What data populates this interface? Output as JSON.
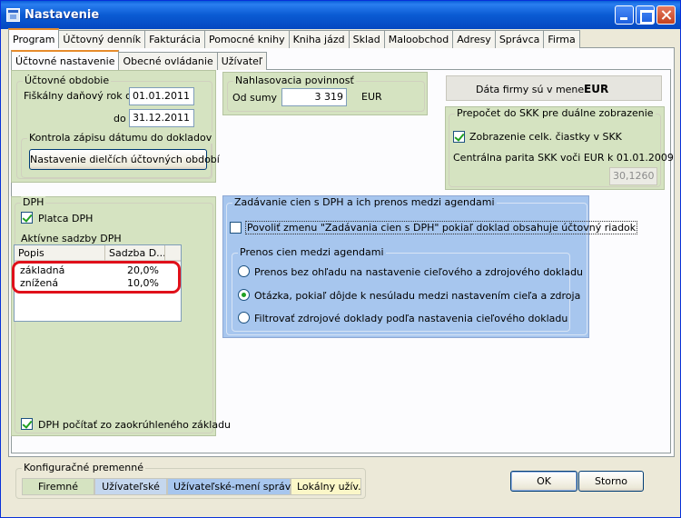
{
  "window": {
    "title": "Nastavenie"
  },
  "main_tabs": [
    "Program",
    "Účtovný denník",
    "Fakturácia",
    "Pomocné knihy",
    "Kniha jázd",
    "Sklad",
    "Maloobchod",
    "Adresy",
    "Správca",
    "Firma"
  ],
  "sub_tabs": [
    "Účtovné nastavenie",
    "Obecné ovládanie",
    "Užívateľ"
  ],
  "accounting_period": {
    "title": "Účtovné obdobie",
    "from_label": "Fiškálny daňový rok od",
    "from_value": "01.01.2011",
    "to_label": "do",
    "to_value": "31.12.2011"
  },
  "date_control": {
    "title": "Kontrola zápisu dátumu do dokladov",
    "button_label": "Nastavenie dielčích účtovných období"
  },
  "reporting": {
    "title": "Nahlasovacia povinnosť",
    "from_sum_label": "Od sumy",
    "amount": "3 319",
    "currency": "EUR"
  },
  "currency_info": {
    "label": "Dáta firmy sú v mene",
    "value": "EUR"
  },
  "conversion": {
    "title": "Prepočet do SKK pre duálne zobrazenie",
    "show_label": "Zobrazenie celk. čiastky v SKK",
    "show_checked": true,
    "parity_label": "Centrálna parita SKK voči EUR k 01.01.2009",
    "parity_value": "30,1260"
  },
  "vat": {
    "title": "DPH",
    "payer_label": "Platca DPH",
    "payer_checked": true,
    "rates_title": "Aktívne sadzby DPH",
    "columns": [
      "Popis",
      "Sadzba D..."
    ],
    "rows": [
      {
        "desc": "základná",
        "rate": "20,0%"
      },
      {
        "desc": "znížená",
        "rate": "10,0%"
      }
    ],
    "rounded_label": "DPH počítať zo zaokrúhleného základu",
    "rounded_checked": true
  },
  "price_entry": {
    "title": "Zadávanie cien s DPH a ich prenos medzi agendami",
    "allow_label": "Povoliť zmenu \"Zadávania cien s DPH\" pokiaľ doklad obsahuje účtovný riadok",
    "allow_checked": false,
    "transfer_title": "Prenos cien medzi agendami",
    "options": [
      "Prenos bez ohľadu na nastavenie cieľového a zdrojového dokladu",
      "Otázka, pokiaľ dôjde k nesúladu medzi nastavením cieľa a zdroja",
      "Filtrovať zdrojové doklady podľa nastavenia cieľového dokladu"
    ],
    "selected_option": 1
  },
  "config": {
    "title": "Konfiguračné premenné",
    "chips": [
      "Firemné",
      "Užívateľské",
      "Užívateľské-mení správca",
      "Lokálny užív."
    ]
  },
  "buttons": {
    "ok": "OK",
    "cancel": "Storno"
  },
  "colors": {
    "green_panel": "#d5e3c1",
    "blue_panel": "#a7c6ee",
    "highlight_red": "#e0101a",
    "title_blue": "#0a5bd3"
  }
}
